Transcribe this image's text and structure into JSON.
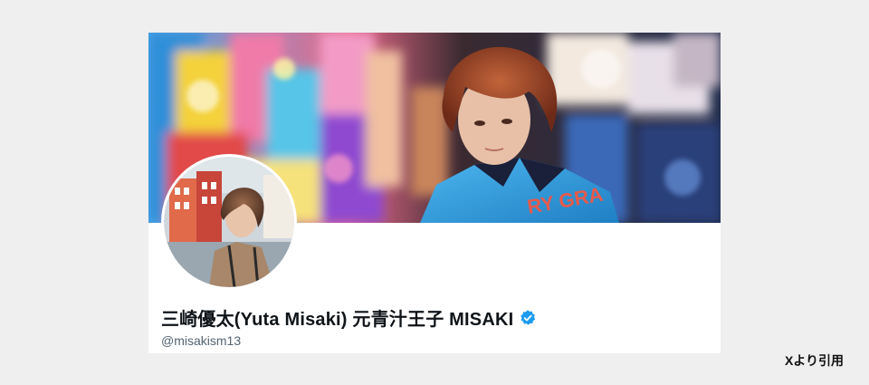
{
  "profile": {
    "display_name": "三崎優太(Yuta Misaki) 元青汁王子 MISAKI",
    "handle": "@misakism13",
    "verified": true,
    "verified_badge_color": "#1d9bf0"
  },
  "banner": {
    "image": "banner-photo"
  },
  "avatar": {
    "image": "avatar-photo"
  },
  "credit": {
    "text": "Xより引用"
  }
}
